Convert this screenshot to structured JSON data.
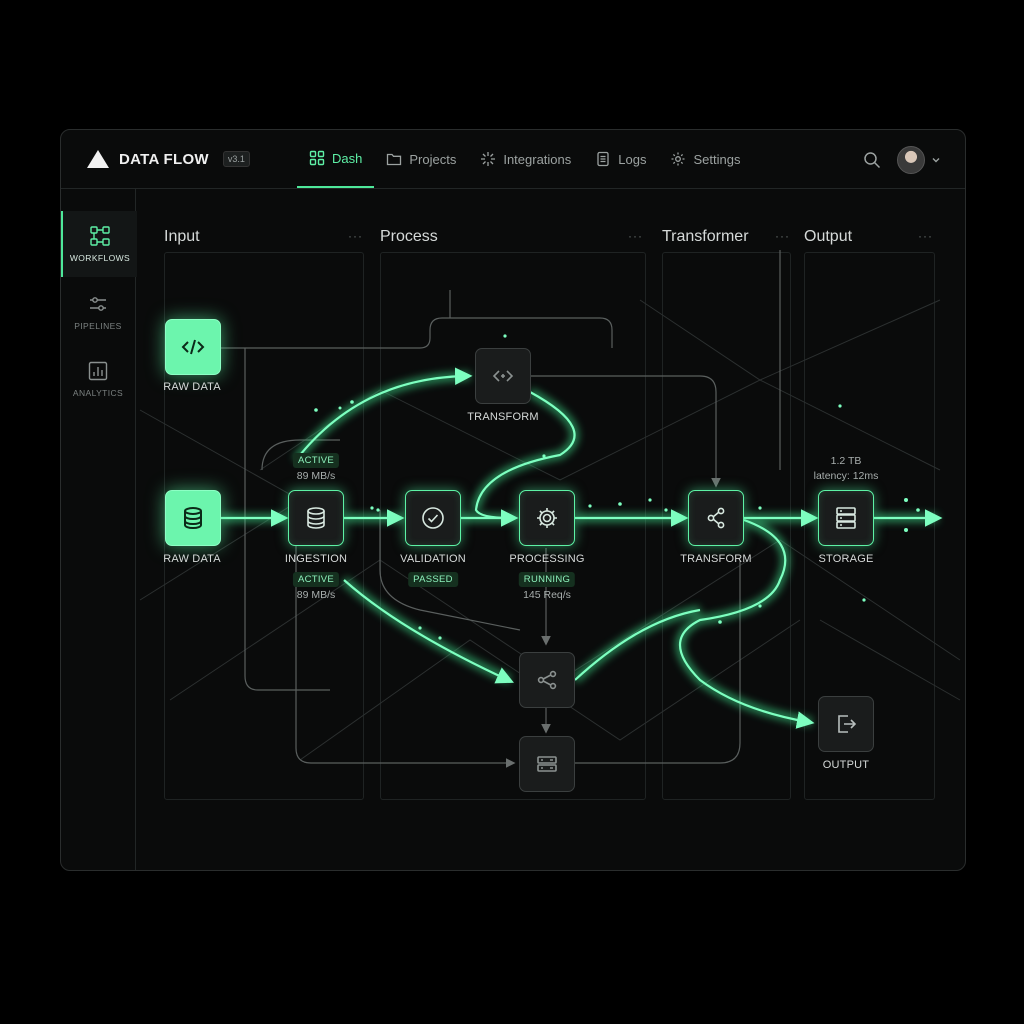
{
  "app": {
    "name": "DATA FLOW",
    "version": "v3.1"
  },
  "nav": [
    {
      "label": "Dash",
      "icon": "grid-icon",
      "active": true
    },
    {
      "label": "Projects",
      "icon": "folder-icon"
    },
    {
      "label": "Integrations",
      "icon": "spark-icon"
    },
    {
      "label": "Logs",
      "icon": "document-icon"
    },
    {
      "label": "Settings",
      "icon": "gear-icon"
    }
  ],
  "sidebar": [
    {
      "label": "WORKFLOWS",
      "icon": "workflow-icon",
      "active": true
    },
    {
      "label": "PIPELINES",
      "icon": "sliders-icon"
    },
    {
      "label": "ANALYTICS",
      "icon": "bar-chart-icon"
    }
  ],
  "columns": [
    {
      "title": "Input"
    },
    {
      "title": "Process"
    },
    {
      "title": "Transformer"
    },
    {
      "title": "Output"
    }
  ],
  "nodes": {
    "raw_data_top": {
      "label": "RAW DATA",
      "icon": "code-icon"
    },
    "raw_data": {
      "label": "RAW DATA",
      "icon": "database-icon"
    },
    "transform_top": {
      "label": "TRANSFORM",
      "icon": "code-icon"
    },
    "ingestion": {
      "label": "INGESTION",
      "badge": "ACTIVE",
      "metric": "89 MB/s",
      "badge_above": "ACTIVE",
      "metric_above": "89 MB/s",
      "icon": "database-icon"
    },
    "validation": {
      "label": "VALIDATION",
      "badge": "PASSED",
      "icon": "check-circle-icon"
    },
    "processing": {
      "label": "PROCESSING",
      "badge": "RUNNING",
      "metric": "145 Req/s",
      "icon": "gear-icon"
    },
    "transform": {
      "label": "TRANSFORM",
      "icon": "share-icon"
    },
    "storage": {
      "label": "STORAGE",
      "metric_size": "1.2 TB",
      "metric_latency": "latency: 12ms",
      "icon": "server-icon"
    },
    "output": {
      "label": "OUTPUT",
      "icon": "exit-icon"
    },
    "branch": {
      "icon": "branch-icon"
    },
    "store_lower": {
      "icon": "server-icon"
    }
  },
  "colors": {
    "accent": "#4ee89a",
    "glow": "#5df2a5",
    "bg": "#0a0b0b"
  }
}
